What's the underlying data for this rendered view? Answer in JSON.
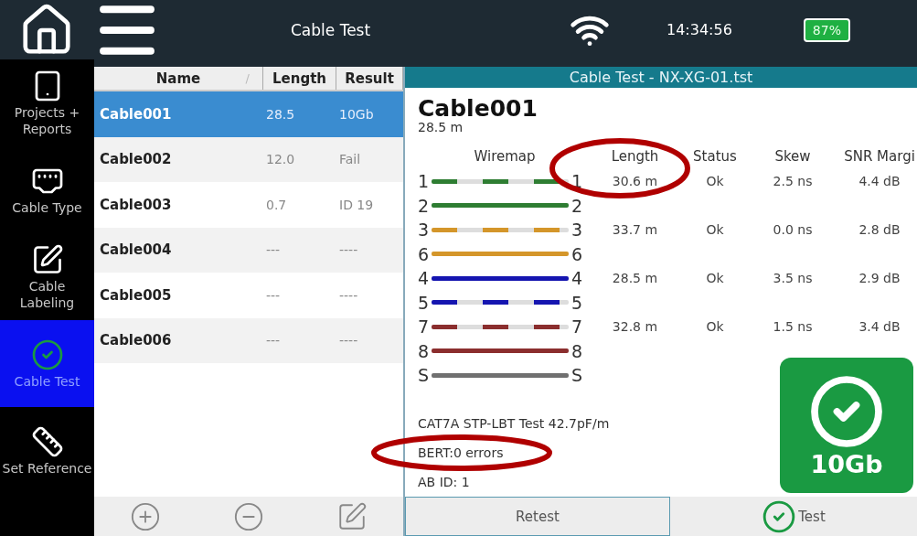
{
  "top_bar": {
    "title": "Cable Test",
    "time": "14:34:56",
    "battery": "87%"
  },
  "sidebar": {
    "items": [
      {
        "kind": "projects",
        "label": "Projects + Reports",
        "selected": false
      },
      {
        "kind": "cable_type",
        "label": "Cable Type",
        "selected": false
      },
      {
        "kind": "labeling",
        "label": "Cable Labeling",
        "selected": false
      },
      {
        "kind": "test",
        "label": "Cable Test",
        "selected": true
      },
      {
        "kind": "reference",
        "label": "Set Reference",
        "selected": false
      }
    ]
  },
  "cable_list": {
    "columns": [
      "Name",
      "Length",
      "Result"
    ],
    "sort_mark": "/",
    "rows": [
      {
        "name": "Cable001",
        "length": "28.5",
        "result": "10Gb",
        "selected": true
      },
      {
        "name": "Cable002",
        "length": "12.0",
        "result": "Fail",
        "selected": false
      },
      {
        "name": "Cable003",
        "length": "0.7",
        "result": "ID 19",
        "selected": false
      },
      {
        "name": "Cable004",
        "length": "---",
        "result": "----",
        "selected": false
      },
      {
        "name": "Cable005",
        "length": "---",
        "result": "----",
        "selected": false
      },
      {
        "name": "Cable006",
        "length": "---",
        "result": "----",
        "selected": false
      }
    ]
  },
  "detail": {
    "header": "Cable Test - NX-XG-01.tst",
    "cable_name": "Cable001",
    "cable_length": "28.5 m",
    "columns": [
      "Wiremap",
      "Length",
      "Status",
      "Skew",
      "SNR Margi"
    ],
    "pairs": [
      {
        "kind": "pair",
        "wires": [
          {
            "start": "1",
            "end": "1",
            "color": "#2e7d32",
            "striped": true
          },
          {
            "start": "2",
            "end": "2",
            "color": "#2e7d32",
            "striped": false
          }
        ],
        "length": "30.6 m",
        "status": "Ok",
        "skew": "2.5 ns",
        "snr": "4.4 dB"
      },
      {
        "kind": "pair",
        "wires": [
          {
            "start": "3",
            "end": "3",
            "color": "#d4962a",
            "striped": true
          },
          {
            "start": "6",
            "end": "6",
            "color": "#d4962a",
            "striped": false
          }
        ],
        "length": "33.7 m",
        "status": "Ok",
        "skew": "0.0 ns",
        "snr": "2.8 dB"
      },
      {
        "kind": "pair",
        "wires": [
          {
            "start": "4",
            "end": "4",
            "color": "#1515b0",
            "striped": false
          },
          {
            "start": "5",
            "end": "5",
            "color": "#1515b0",
            "striped": true
          }
        ],
        "length": "28.5 m",
        "status": "Ok",
        "skew": "3.5 ns",
        "snr": "2.9 dB"
      },
      {
        "kind": "pair",
        "wires": [
          {
            "start": "7",
            "end": "7",
            "color": "#8b2e2e",
            "striped": true
          },
          {
            "start": "8",
            "end": "8",
            "color": "#8b2e2e",
            "striped": false
          }
        ],
        "length": "32.8 m",
        "status": "Ok",
        "skew": "1.5 ns",
        "snr": "3.4 dB"
      },
      {
        "kind": "shield",
        "wires": [
          {
            "start": "S",
            "end": "S",
            "color": "#707070",
            "striped": false
          }
        ]
      }
    ],
    "notes": [
      "CAT7A STP-LBT  Test  42.7pF/m",
      "BERT:0 errors",
      "AB ID: 1"
    ],
    "verdict": "10Gb",
    "buttons": [
      {
        "kind": "retest",
        "label": "Retest"
      },
      {
        "kind": "test",
        "label": "Test"
      }
    ]
  }
}
